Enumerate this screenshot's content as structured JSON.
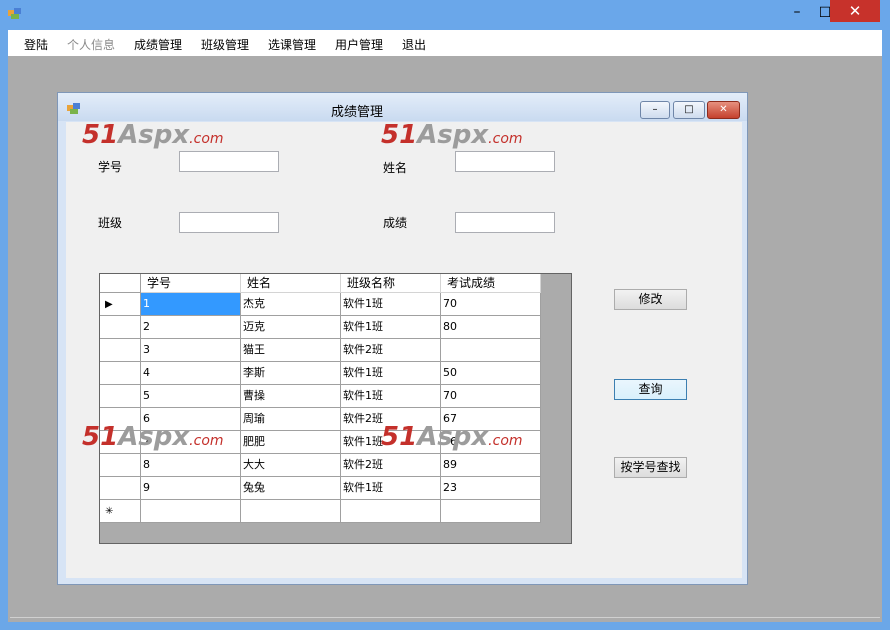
{
  "outer_window": {
    "min_glyph": "–",
    "max_glyph": "☐",
    "close_glyph": "✕"
  },
  "menu": [
    {
      "label": "登陆",
      "disabled": false
    },
    {
      "label": "个人信息",
      "disabled": true
    },
    {
      "label": "成绩管理",
      "disabled": false
    },
    {
      "label": "班级管理",
      "disabled": false
    },
    {
      "label": "选课管理",
      "disabled": false
    },
    {
      "label": "用户管理",
      "disabled": false
    },
    {
      "label": "退出",
      "disabled": false
    }
  ],
  "child_window": {
    "title": "成绩管理",
    "min_glyph": "–",
    "max_glyph": "□",
    "close_glyph": "✕"
  },
  "form": {
    "student_id_label": "学号",
    "student_id_value": "",
    "name_label": "姓名",
    "name_value": "",
    "class_label": "班级",
    "class_value": "",
    "score_label": "成绩",
    "score_value": ""
  },
  "grid": {
    "columns": [
      "学号",
      "姓名",
      "班级名称",
      "考试成绩"
    ],
    "rows": [
      [
        "1",
        "杰克",
        "软件1班",
        "70"
      ],
      [
        "2",
        "迈克",
        "软件1班",
        "80"
      ],
      [
        "3",
        "猫王",
        "软件2班",
        ""
      ],
      [
        "4",
        "李斯",
        "软件1班",
        "50"
      ],
      [
        "5",
        "曹操",
        "软件1班",
        "70"
      ],
      [
        "6",
        "周瑜",
        "软件2班",
        "67"
      ],
      [
        "7",
        "肥肥",
        "软件1班",
        "76"
      ],
      [
        "8",
        "大大",
        "软件2班",
        "89"
      ],
      [
        "9",
        "兔兔",
        "软件1班",
        "23"
      ]
    ],
    "current_row_marker": "▶",
    "new_row_marker": "✳"
  },
  "buttons": {
    "modify": "修改",
    "query": "查询",
    "search_by_id": "按学号查找"
  },
  "watermark": {
    "num": "51",
    "main": "Aspx",
    "suffix": ".com"
  }
}
